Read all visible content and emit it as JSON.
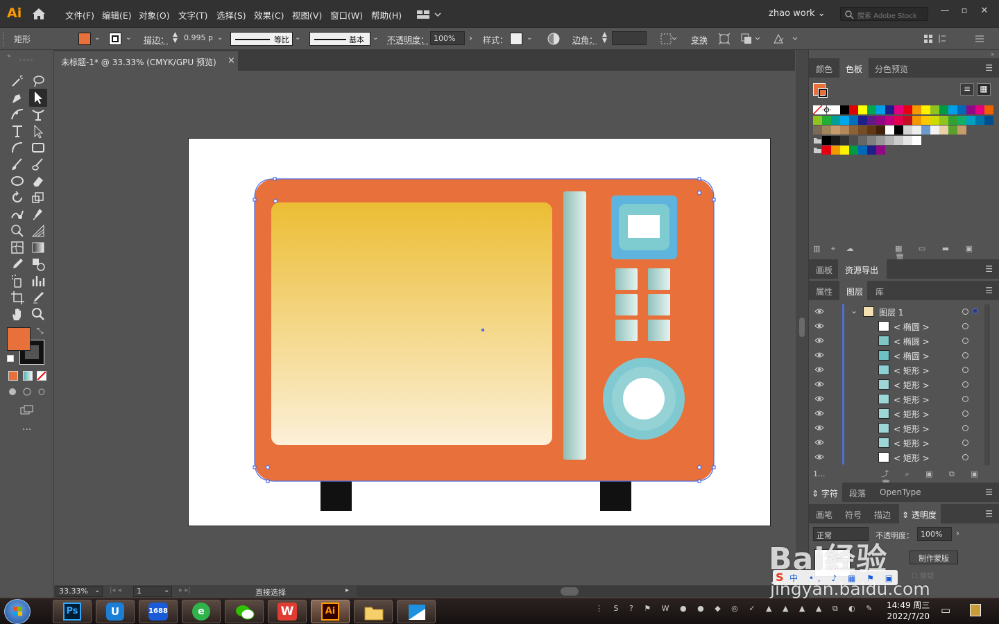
{
  "app": {
    "logo": "Ai",
    "menu": [
      "文件(F)",
      "编辑(E)",
      "对象(O)",
      "文字(T)",
      "选择(S)",
      "效果(C)",
      "视图(V)",
      "窗口(W)",
      "帮助(H)"
    ],
    "workspace": "zhao work",
    "stock_search_placeholder": "搜索 Adobe Stock",
    "accent": "#ff9a00"
  },
  "control_bar": {
    "selection_type": "矩形",
    "fill_color": "#e8703a",
    "stroke_label": "描边：",
    "stroke_weight": "0.995 p",
    "stroke_profile": "等比",
    "brush": "基本",
    "opacity_label": "不透明度：",
    "opacity": "100%",
    "style_label": "样式：",
    "corner_label": "边角：",
    "transform_label": "变换"
  },
  "document": {
    "tab_title": "未标题-1* @ 33.33% (CMYK/GPU 预览)",
    "close": "×"
  },
  "status": {
    "zoom": "33.33%",
    "page": "1",
    "current_tool": "直接选择"
  },
  "panels": {
    "swatch_tabs": [
      "颜色",
      "色板",
      "分色预览"
    ],
    "artboard_tabs": [
      "画板",
      "资源导出"
    ],
    "layer_tabs": [
      "属性",
      "图层",
      "库"
    ],
    "layer_count": "1...",
    "layers": [
      {
        "name": "图层 1",
        "thumb": "#f4e0b0"
      },
      {
        "name": "< 椭圆 >",
        "thumb": "#ffffff"
      },
      {
        "name": "< 椭圆 >",
        "thumb": "#80c8c8"
      },
      {
        "name": "< 椭圆 >",
        "thumb": "#6ec0c4"
      },
      {
        "name": "< 矩形 >",
        "thumb": "#8fd0d4"
      },
      {
        "name": "< 矩形 >",
        "thumb": "#9ed6d8"
      },
      {
        "name": "< 矩形 >",
        "thumb": "#9ed6d8"
      },
      {
        "name": "< 矩形 >",
        "thumb": "#9ed6d8"
      },
      {
        "name": "< 矩形 >",
        "thumb": "#9ed6d8"
      },
      {
        "name": "< 矩形 >",
        "thumb": "#9ed6d8"
      },
      {
        "name": "< 矩形 >",
        "thumb": "#ffffff"
      }
    ],
    "char_tabs": [
      "字符",
      "段落",
      "OpenType"
    ],
    "trans_tabs": [
      "画笔",
      "符号",
      "描边",
      "透明度"
    ],
    "blend_mode": "正常",
    "trans_opacity_label": "不透明度：",
    "trans_opacity": "100%",
    "make_mask": "制作蒙版",
    "clip": "剪切"
  },
  "taskbar": {
    "apps": [
      "Ps",
      "U",
      "1688",
      "e",
      "WeChat",
      "W",
      "Ai",
      "Files",
      "Docs"
    ],
    "time": "14:49 周三",
    "date": "2022/7/20"
  },
  "watermark": {
    "text": "Bai经验",
    "url": "jingyan.baidu.com"
  }
}
